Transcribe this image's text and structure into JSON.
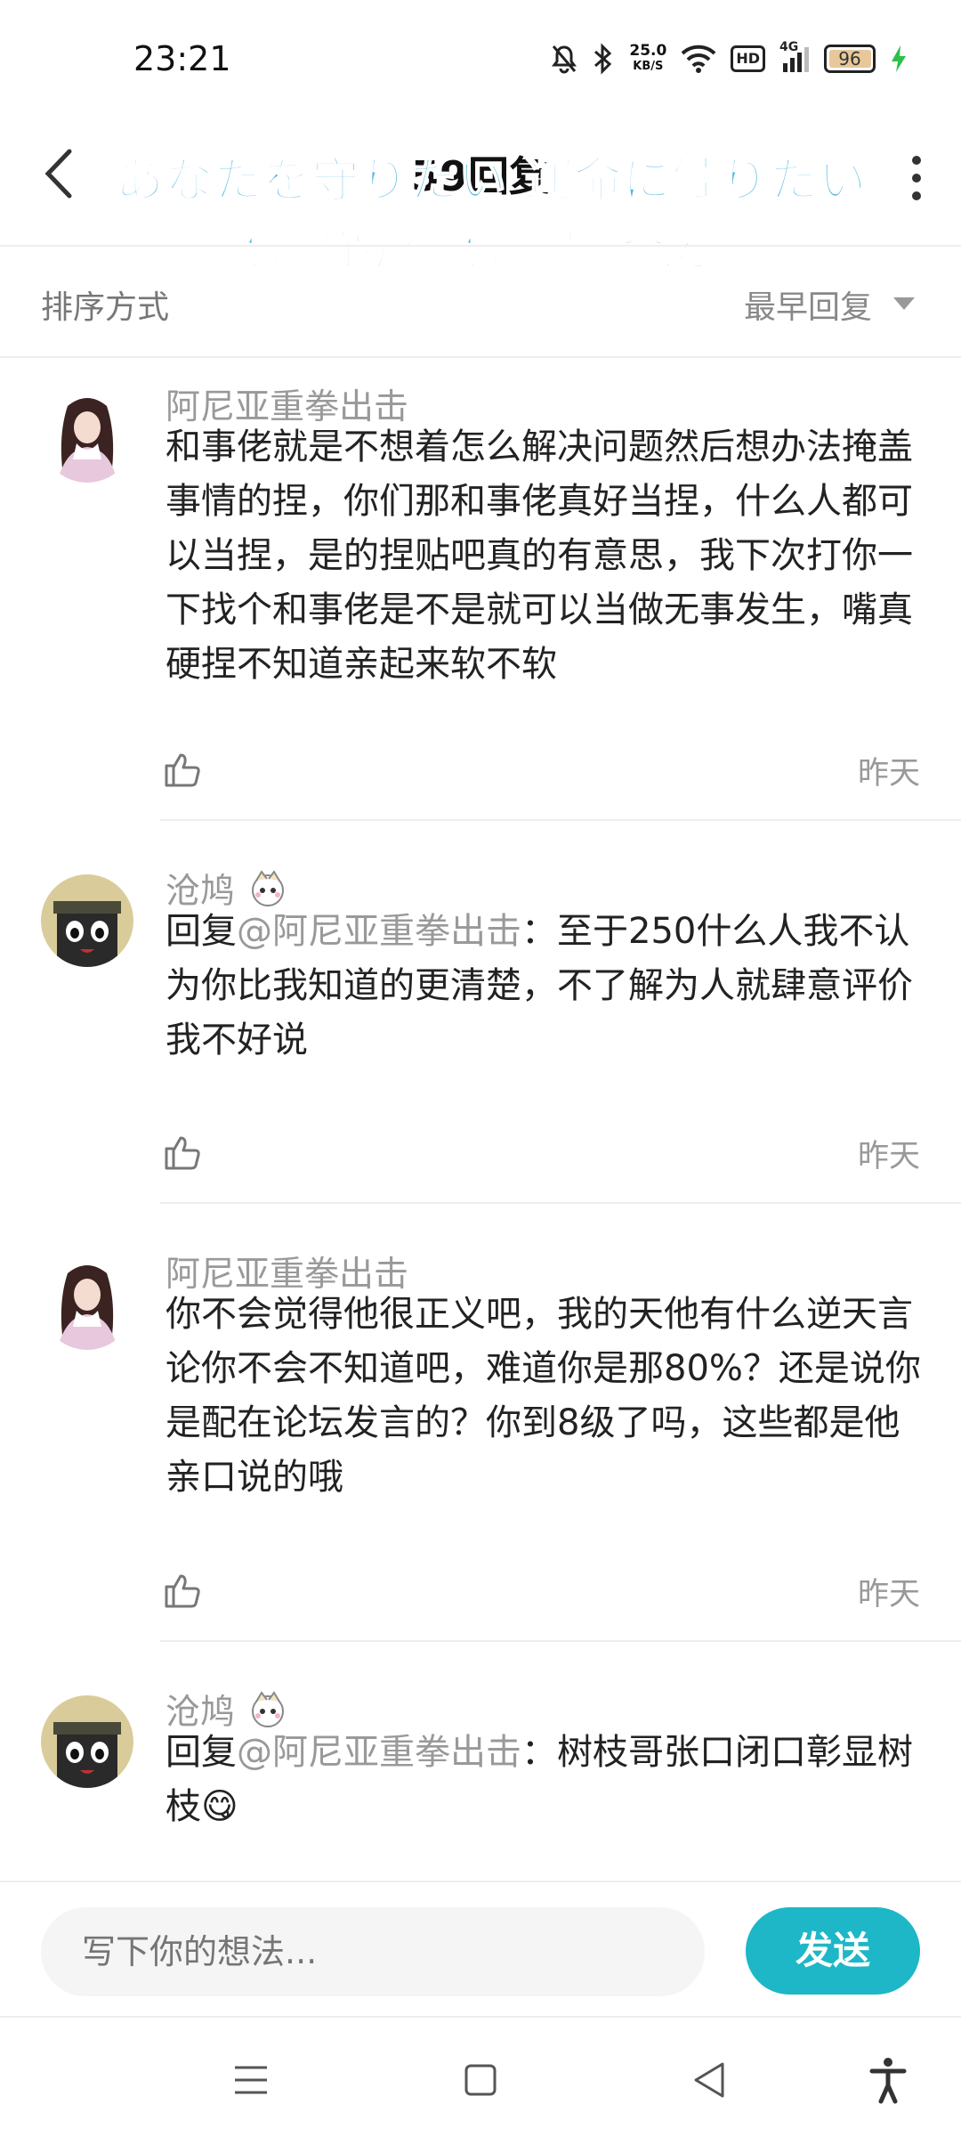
{
  "status_bar": {
    "time": "23:21",
    "net_speed_value": "25.0",
    "net_speed_unit": "KB/S",
    "hd": "HD",
    "network": "4G",
    "battery": "96"
  },
  "header": {
    "title": "59回复",
    "watermark_line1": "あなたを守りたい 運命に触りたい",
    "watermark_line2": "想要守护你 想要触摸命运"
  },
  "sort": {
    "label": "排序方式",
    "value": "最早回复"
  },
  "comments": [
    {
      "user": "阿尼亚重拳出击",
      "mention": "",
      "prefix": "",
      "text": "和事佬就是不想着怎么解决问题然后想办法掩盖事情的捏，你们那和事佬真好当捏，什么人都可以当捏，是的捏贴吧真的有意思，我下次打你一下找个和事佬是不是就可以当做无事发生，嘴真硬捏不知道亲起来软不软",
      "date": "昨天"
    },
    {
      "user": "沧鸠",
      "prefix": "回复",
      "mention": "@阿尼亚重拳出击",
      "text": "：至于250什么人我不认为你比我知道的更清楚，不了解为人就肆意评价我不好说",
      "date": "昨天"
    },
    {
      "user": "阿尼亚重拳出击",
      "mention": "",
      "prefix": "",
      "text": "你不会觉得他很正义吧，我的天他有什么逆天言论你不会不知道吧，难道你是那80%？还是说你是配在论坛发言的？你到8级了吗，这些都是他亲口说的哦",
      "date": "昨天"
    },
    {
      "user": "沧鸠",
      "prefix": "回复",
      "mention": "@阿尼亚重拳出击",
      "text": "：树枝哥张口闭口彰显树枝😋",
      "date": ""
    }
  ],
  "input": {
    "placeholder": "写下你的想法...",
    "send_label": "发送"
  }
}
